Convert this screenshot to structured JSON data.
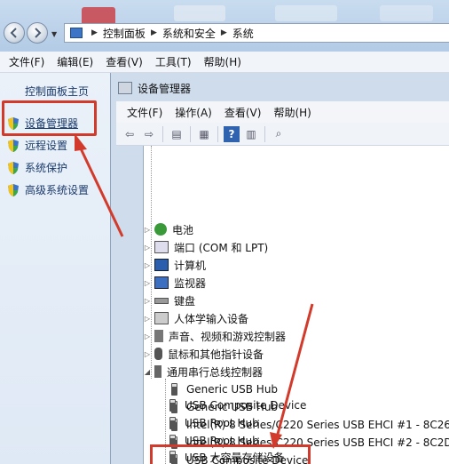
{
  "address_bar": {
    "crumbs": [
      "控制面板",
      "系统和安全",
      "系统"
    ]
  },
  "menubar": {
    "items": [
      "文件(F)",
      "编辑(E)",
      "查看(V)",
      "工具(T)",
      "帮助(H)"
    ]
  },
  "left_pane": {
    "home_label": "控制面板主页",
    "items": [
      {
        "label": "设备管理器",
        "icon": "shield-icon",
        "highlighted": true
      },
      {
        "label": "远程设置",
        "icon": "shield-icon"
      },
      {
        "label": "系统保护",
        "icon": "shield-icon"
      },
      {
        "label": "高级系统设置",
        "icon": "shield-icon"
      }
    ]
  },
  "device_manager": {
    "title": "设备管理器",
    "menu": [
      "文件(F)",
      "操作(A)",
      "查看(V)",
      "帮助(H)"
    ],
    "categories": [
      {
        "label": "电池",
        "icon": "battery-icon"
      },
      {
        "label": "端口 (COM 和 LPT)",
        "icon": "port-icon"
      },
      {
        "label": "计算机",
        "icon": "computer-icon"
      },
      {
        "label": "监视器",
        "icon": "monitor-icon"
      },
      {
        "label": "键盘",
        "icon": "keyboard-icon"
      },
      {
        "label": "人体学输入设备",
        "icon": "hid-icon"
      },
      {
        "label": "声音、视频和游戏控制器",
        "icon": "speaker-icon"
      },
      {
        "label": "鼠标和其他指针设备",
        "icon": "mouse-icon"
      },
      {
        "label": "通用串行总线控制器",
        "icon": "usb-icon",
        "expanded": true
      }
    ],
    "usb_devices": [
      "Generic USB Hub",
      "Generic USB Hub",
      "Intel(R) 8 Series/C220 Series USB EHCI #1 - 8C26",
      "Intel(R) 8 Series/C220 Series USB EHCI #2 - 8C2D",
      "USB Composite Device",
      "USB Composite Device",
      "USB Root Hub",
      "USB Root Hub",
      "USB 大容量存储设备"
    ]
  },
  "colors": {
    "highlight_red": "#d23b2b",
    "link_blue": "#1a3a6b"
  }
}
